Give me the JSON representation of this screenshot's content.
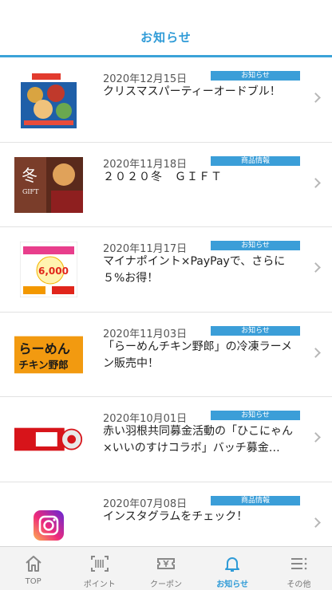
{
  "header": {
    "title": "お知らせ"
  },
  "news": [
    {
      "date": "2020年12月15日",
      "category": "お知らせ",
      "title": "クリスマスパーティーオードブル！",
      "thumb": "christmas-hors-doeuvre-flyer"
    },
    {
      "date": "2020年11月18日",
      "category": "商品情報",
      "title": "２０２０冬　ＧＩＦＴ",
      "thumb": "winter-gift-2020"
    },
    {
      "date": "2020年11月17日",
      "category": "お知らせ",
      "title": "マイナポイント×PayPayで、さらに５%お得！",
      "thumb": "mynapoint-paypay-6000"
    },
    {
      "date": "2020年11月03日",
      "category": "お知らせ",
      "title": "「らーめんチキン野郎」の冷凍ラーメン販売中！",
      "thumb": "ramen-chicken-yaro-logo"
    },
    {
      "date": "2020年10月01日",
      "category": "お知らせ",
      "title": "赤い羽根共同募金活動の「ひこにゃん×いいのすけコラボ」バッチ募金…",
      "thumb": "red-feather-donation"
    },
    {
      "date": "2020年07月08日",
      "category": "商品情報",
      "title": "インスタグラムをチェック！",
      "thumb": "instagram-logo"
    }
  ],
  "thumb_texts": {
    "ramen_line1": "らーめん",
    "ramen_line2": "チキン野郎",
    "winter": "冬",
    "winter_sub": "GIFT",
    "point_amount": "6,000"
  },
  "tabs": [
    {
      "label": "TOP",
      "icon": "home-icon",
      "active": false
    },
    {
      "label": "ポイント",
      "icon": "barcode-scan-icon",
      "active": false
    },
    {
      "label": "クーポン",
      "icon": "yen-ticket-icon",
      "active": false
    },
    {
      "label": "お知らせ",
      "icon": "bell-icon",
      "active": true
    },
    {
      "label": "その他",
      "icon": "menu-icon",
      "active": false
    }
  ],
  "colors": {
    "accent": "#2f9bd7",
    "badge": "#3b9ed8",
    "tab_inactive": "#777777"
  }
}
